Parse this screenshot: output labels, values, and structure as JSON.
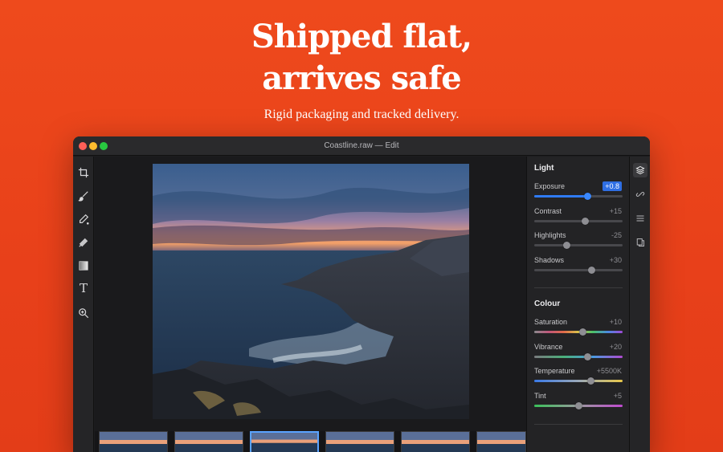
{
  "hero": {
    "title_line1": "Shipped flat,",
    "title_line2": "arrives safe",
    "subtitle": "Rigid packaging and tracked delivery."
  },
  "window": {
    "title": "Coastline.raw — Edit"
  },
  "tools": [
    {
      "name": "crop-icon"
    },
    {
      "name": "brush-icon"
    },
    {
      "name": "eyedropper-icon"
    },
    {
      "name": "healing-icon"
    },
    {
      "name": "gradient-icon"
    },
    {
      "name": "text-icon",
      "glyph": "T"
    },
    {
      "name": "zoom-icon"
    }
  ],
  "panel": {
    "light": {
      "title": "Light",
      "sliders": [
        {
          "label": "Exposure",
          "value": "+0.8",
          "level": 0.6,
          "active": true
        },
        {
          "label": "Contrast",
          "value": "+15",
          "level": 0.58
        },
        {
          "label": "Highlights",
          "value": "-25",
          "level": 0.37
        },
        {
          "label": "Shadows",
          "value": "+30",
          "level": 0.65
        }
      ]
    },
    "colour": {
      "title": "Colour",
      "sliders": [
        {
          "label": "Saturation",
          "value": "+10",
          "level": 0.55
        },
        {
          "label": "Vibrance",
          "value": "+20",
          "level": 0.6
        },
        {
          "label": "Temperature",
          "value": "+5500K",
          "level": 0.64
        },
        {
          "label": "Tint",
          "value": "+5",
          "level": 0.5
        }
      ]
    }
  },
  "rail": [
    {
      "name": "layers-icon",
      "active": true
    },
    {
      "name": "link-icon"
    },
    {
      "name": "list-icon"
    },
    {
      "name": "copy-icon"
    }
  ],
  "colors": {
    "background": "#e8401a",
    "accent": "#2f7bf5",
    "window": "#1c1c1e"
  }
}
